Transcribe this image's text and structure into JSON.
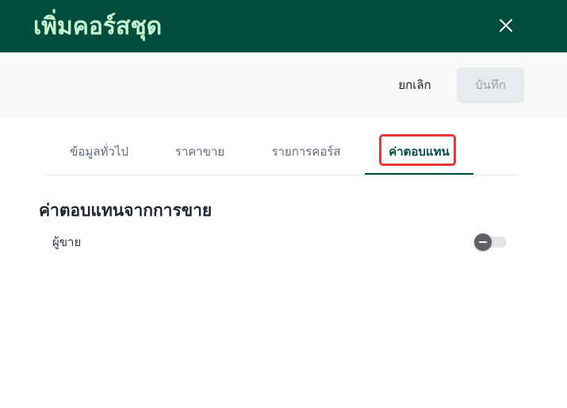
{
  "header": {
    "title": "เพิ่มคอร์สชุด"
  },
  "actions": {
    "cancel_label": "ยกเลิก",
    "save_label": "บันทึก"
  },
  "tabs": [
    {
      "label": "ข้อมูลทั่วไป",
      "active": false
    },
    {
      "label": "ราคาขาย",
      "active": false
    },
    {
      "label": "รายการคอร์ส",
      "active": false
    },
    {
      "label": "ค่าตอบแทน",
      "active": true
    }
  ],
  "section": {
    "title": "ค่าตอบแทนจากการขาย",
    "rows": [
      {
        "label": "ผู้ขาย",
        "toggle_state": "indeterminate"
      }
    ]
  },
  "colors": {
    "header_bg": "#004d40",
    "header_title": "#c8f3cf",
    "active_tab": "#004d40",
    "highlight": "#e53935"
  },
  "icons": {
    "close": "close-icon"
  }
}
